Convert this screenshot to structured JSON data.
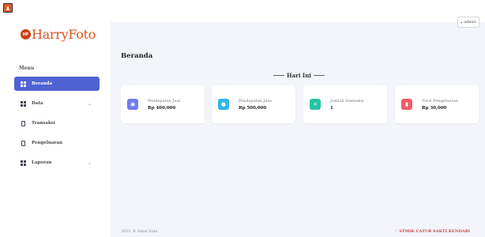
{
  "app": {
    "brand_badge": "HF",
    "brand_name": "HarryFoto"
  },
  "sidebar": {
    "menu_heading": "Menu",
    "items": [
      {
        "label": "Beranda",
        "icon": "dashboard-grid-icon",
        "active": true,
        "has_submenu": false
      },
      {
        "label": "Data",
        "icon": "data-grid-icon",
        "active": false,
        "has_submenu": true
      },
      {
        "label": "Transaksi",
        "icon": "document-icon",
        "active": false,
        "has_submenu": false
      },
      {
        "label": "Pengeluaran",
        "icon": "document-icon",
        "active": false,
        "has_submenu": false
      },
      {
        "label": "Laporan",
        "icon": "report-grid-icon",
        "active": false,
        "has_submenu": true
      }
    ]
  },
  "topbar": {
    "user_label": "admin"
  },
  "main": {
    "page_title": "Beranda",
    "period_label": "Hari Ini",
    "cards": [
      {
        "label": "Pendapatan Jual",
        "value": "Rp 400,000",
        "icon": "eye-icon",
        "color": "#6f7cf0"
      },
      {
        "label": "Pendapatan Jasa",
        "value": "Rp 500,000",
        "icon": "user-icon",
        "color": "#2fb6e8"
      },
      {
        "label": "Jumlah transaksi",
        "value": "1",
        "icon": "user-plus-icon",
        "color": "#27c5a3"
      },
      {
        "label": "Total Pengeluaran",
        "value": "Rp 30,000",
        "icon": "bookmark-icon",
        "color": "#ef5b68"
      }
    ]
  },
  "footer": {
    "copyright": "2022 © Amal Saia",
    "credit": "♡ STMIK CATUR SAKTI KENDARI"
  },
  "colors": {
    "accent": "#4e63d3",
    "brand": "#d9531e"
  }
}
